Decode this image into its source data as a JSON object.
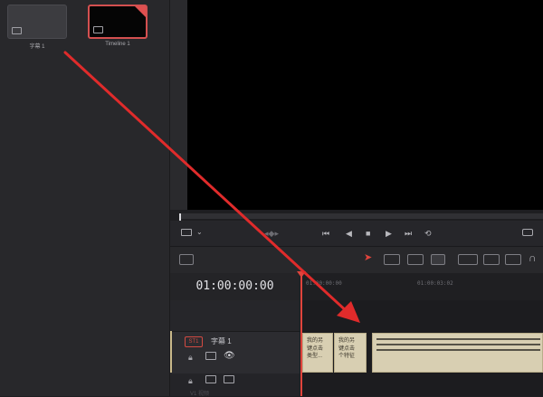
{
  "media_pool": {
    "clips": [
      {
        "label": "字幕 1"
      },
      {
        "label": "Timeline 1"
      }
    ]
  },
  "timeline": {
    "timecode": "01:00:00:00",
    "ruler_labels": [
      "01:00:00:00",
      "01:00:03:02"
    ],
    "subtitle_track": {
      "badge": "ST1",
      "name": "字幕 1"
    },
    "next_track_label": "V1 视频"
  },
  "subtitle_clips": [
    {
      "lines": [
        "我的另",
        "键点击",
        "类型..."
      ]
    },
    {
      "lines": [
        "我的另",
        "键点击",
        "个特征"
      ]
    }
  ],
  "colors": {
    "accent_red": "#e0443c",
    "subtitle_clip": "#d8cfb2",
    "annotation_arrow": "#e02b2b"
  },
  "icons": {
    "transport": [
      "jump-to-start-icon",
      "step-back-icon",
      "stop-icon",
      "play-icon",
      "jump-to-end-icon",
      "loop-icon"
    ],
    "annotation": "red-arrow"
  }
}
